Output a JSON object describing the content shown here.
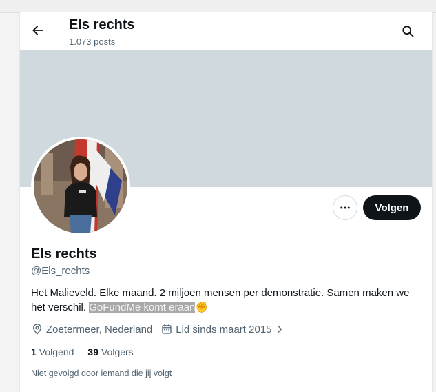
{
  "header": {
    "title": "Els rechts",
    "posts": "1.073 posts",
    "back_icon": "arrow-left-icon",
    "search_icon": "search-icon"
  },
  "profile": {
    "name": "Els rechts",
    "handle": "@Els_rechts",
    "bio_text": "Het Malieveld. Elke maand. 2 miljoen mensen per demonstratie. Samen maken we het verschil.",
    "bio_highlight": "GoFundMe komt eraan",
    "bio_emoji": "✊",
    "location": "Zoetermeer, Nederland",
    "joined": "Lid sinds maart 2015",
    "following_count": "1",
    "following_label": "Volgend",
    "followers_count": "39",
    "followers_label": "Volgers",
    "not_followed_note": "Niet gevolgd door iemand die jij volgt"
  },
  "actions": {
    "follow_label": "Volgen",
    "more_icon": "more-horizontal-icon"
  },
  "colors": {
    "banner": "#cfd9de",
    "follow_button": "#0f1419",
    "secondary_text": "#536471"
  }
}
